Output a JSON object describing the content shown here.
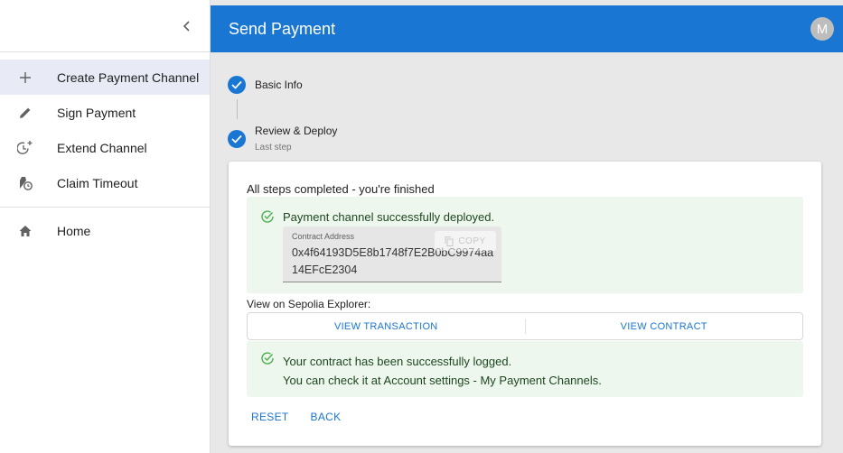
{
  "appbar": {
    "title": "Send Payment",
    "avatar_initial": "M"
  },
  "sidebar": {
    "items": [
      {
        "label": "Create Payment Channel",
        "icon": "plus-icon"
      },
      {
        "label": "Sign Payment",
        "icon": "pencil-icon"
      },
      {
        "label": "Extend Channel",
        "icon": "clock-plus-icon"
      },
      {
        "label": "Claim Timeout",
        "icon": "bag-clock-icon"
      },
      {
        "label": "Home",
        "icon": "home-icon"
      }
    ]
  },
  "stepper": {
    "steps": [
      {
        "label": "Basic Info",
        "sub": ""
      },
      {
        "label": "Review & Deploy",
        "sub": "Last step"
      }
    ]
  },
  "card": {
    "heading": "All steps completed - you're finished",
    "deploy_message": "Payment channel successfully deployed.",
    "address_label": "Contract Address",
    "address_value": "0x4f64193D5E8b1748f7E2B0bC9974aa14EFcE2304",
    "copy_label": "COPY",
    "explorer_label": "View on Sepolia Explorer:",
    "view_transaction": "VIEW TRANSACTION",
    "view_contract": "VIEW CONTRACT",
    "logged_line1": "Your contract has been successfully logged.",
    "logged_line2": "You can check it at Account settings - My Payment Channels.",
    "reset_label": "RESET",
    "back_label": "BACK"
  },
  "colors": {
    "primary": "#1976d2",
    "success_bg": "#edf7ed",
    "success_fg": "#1e4620"
  }
}
